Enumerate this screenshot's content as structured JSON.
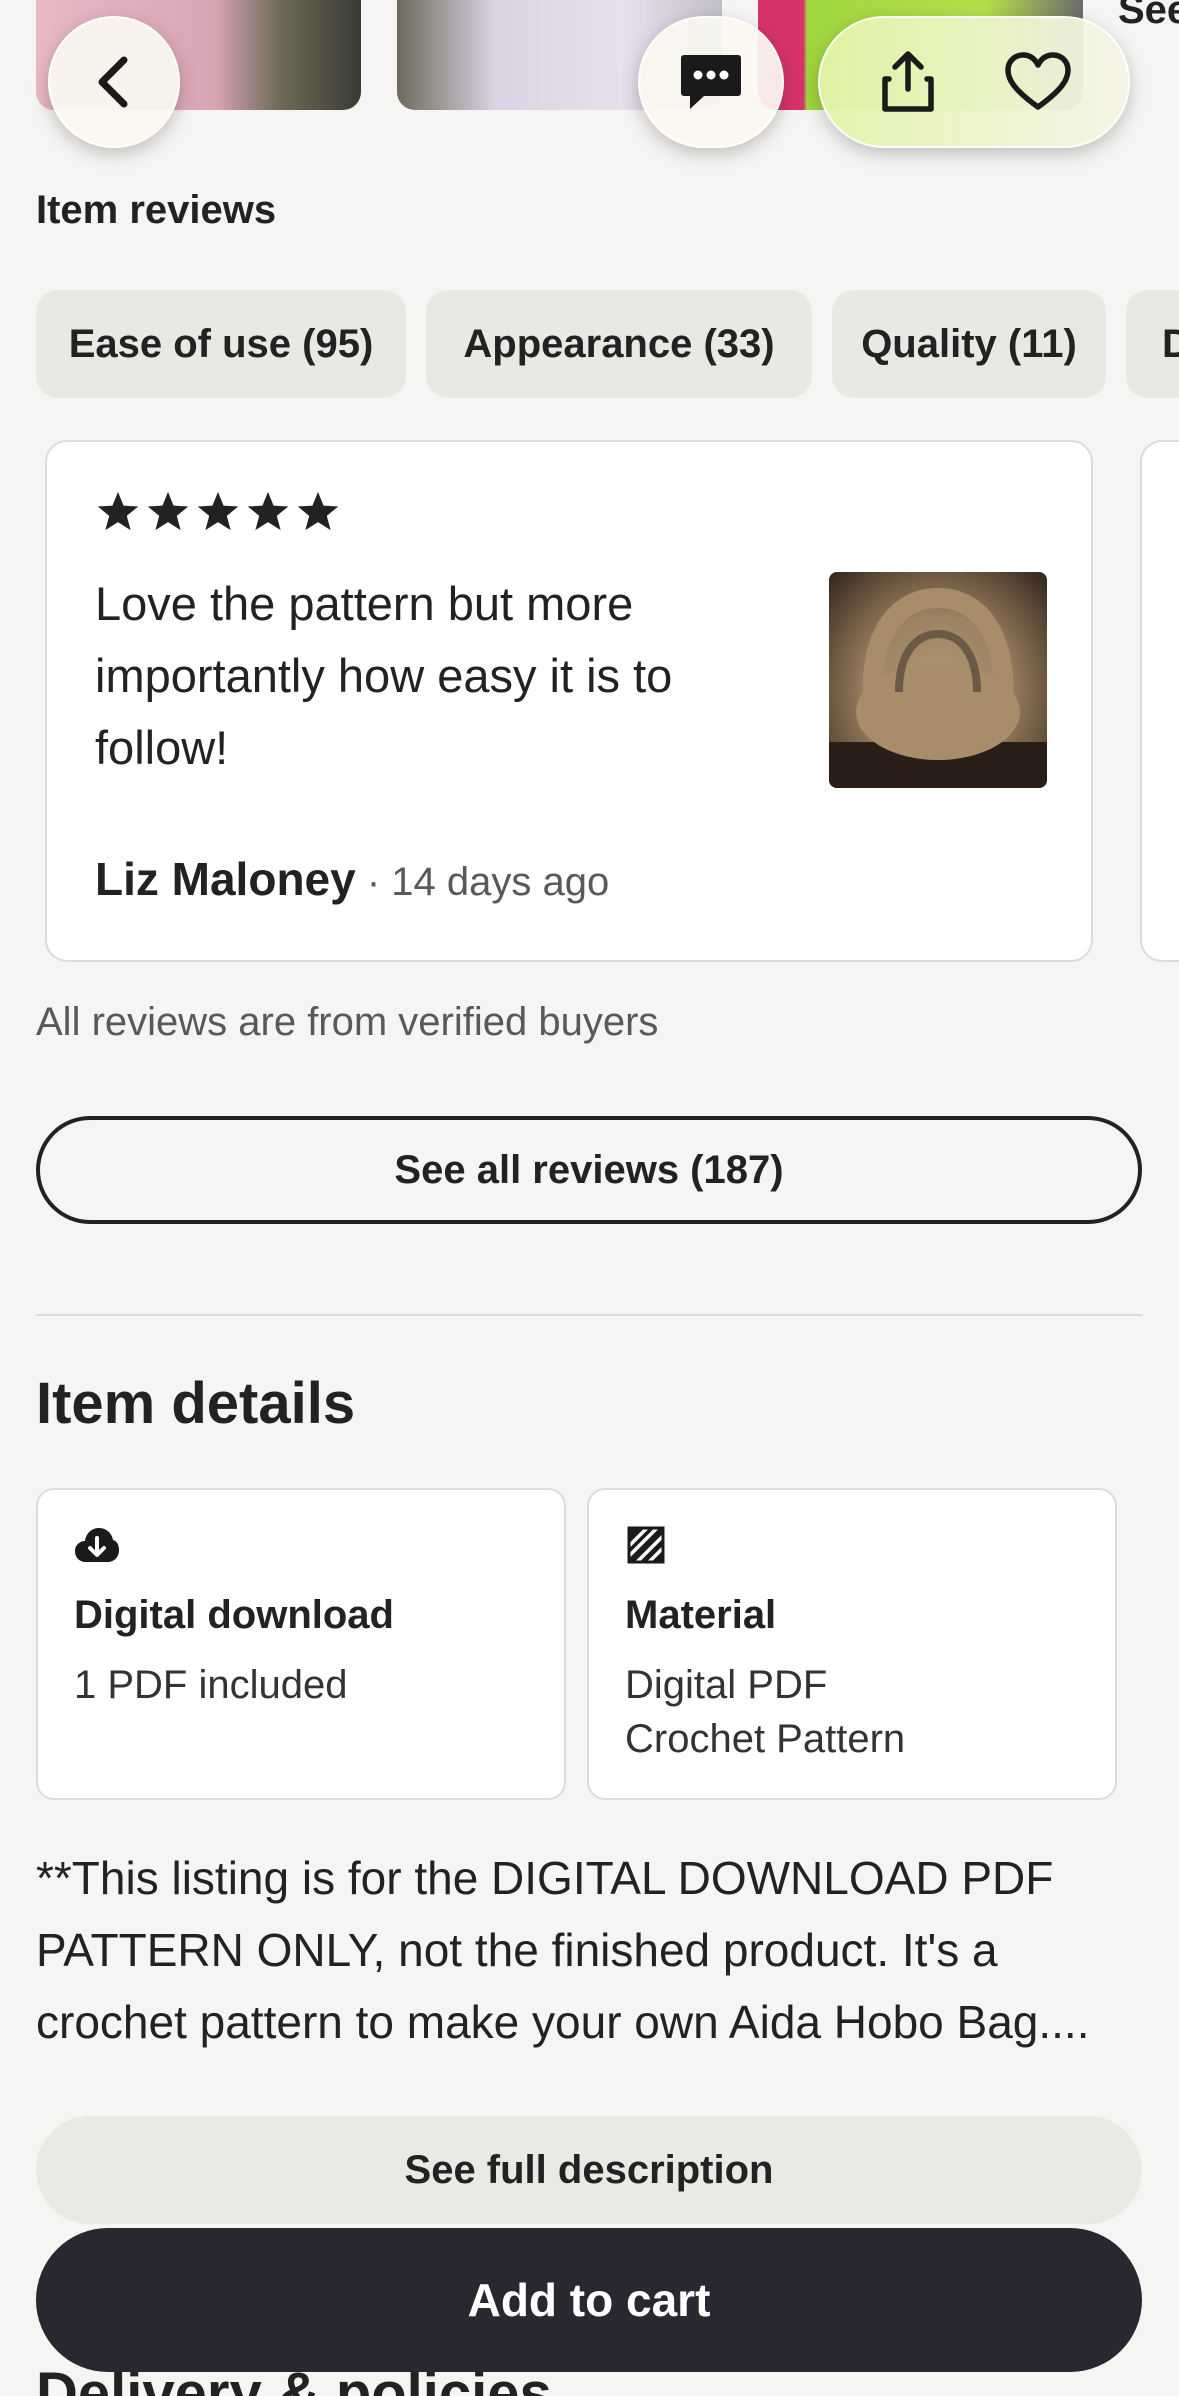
{
  "header": {
    "see_label": "See"
  },
  "reviews": {
    "section_title": "Item reviews",
    "chips": [
      {
        "label": "Ease of use (95)"
      },
      {
        "label": "Appearance (33)"
      },
      {
        "label": "Quality (11)"
      },
      {
        "label": "D"
      }
    ],
    "card": {
      "rating": 5,
      "text": "Love the pattern but more importantly how easy it is to follow!",
      "reviewer": "Liz Maloney",
      "separator": " · ",
      "date": "14 days ago"
    },
    "verified_note": "All reviews are from verified buyers",
    "see_all_label": "See all reviews (187)"
  },
  "details": {
    "title": "Item details",
    "cards": [
      {
        "icon": "download-icon",
        "title": "Digital download",
        "value": "1 PDF included"
      },
      {
        "icon": "material-icon",
        "title": "Material",
        "value_line1": "Digital PDF",
        "value_line2": "Crochet Pattern"
      }
    ],
    "description": "**This listing is for the DIGITAL DOWNLOAD PDF PATTERN ONLY, not the finished product. It's a crochet pattern to make your own Aida Hobo Bag....",
    "see_full_label": "See full description"
  },
  "cart": {
    "add_to_cart_label": "Add to cart"
  },
  "next_section": {
    "title": "Delivery & policies"
  },
  "colors": {
    "background": "#f6f5f3",
    "text": "#222222",
    "secondary_text": "#595959",
    "cart_button": "#2b2730",
    "chip_bg": "#e9e8e5"
  }
}
